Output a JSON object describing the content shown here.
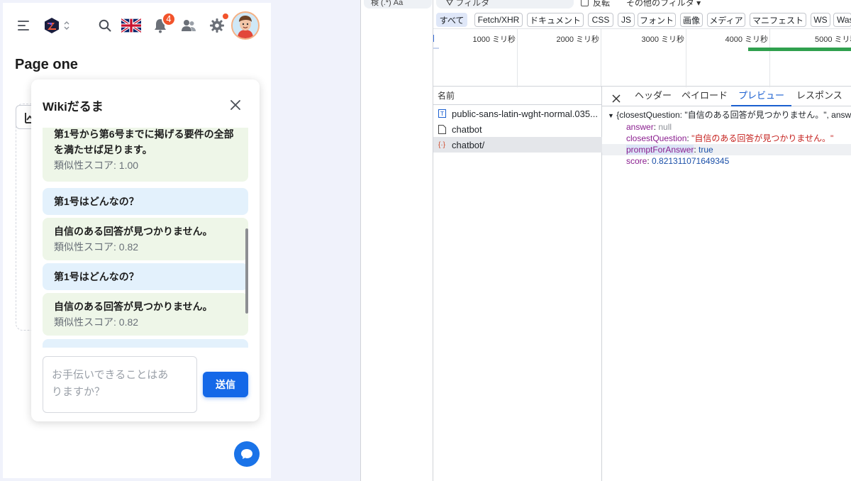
{
  "app": {
    "notification_count": "4",
    "page_title": "Page one",
    "chat": {
      "title": "Wikiだるま",
      "messages": [
        {
          "role": "bot",
          "text_lines": [
            "第1号から第6号までに掲げる要件の全部",
            "を満たせば足ります。"
          ],
          "score": "類似性スコア: 1.00"
        },
        {
          "role": "user",
          "text_lines": [
            "第1号はどんなの？"
          ]
        },
        {
          "role": "bot",
          "text_lines": [
            "自信のある回答が見つかりません。"
          ],
          "score": "類似性スコア: 0.82"
        },
        {
          "role": "user",
          "text_lines": [
            "第1号はどんなの？"
          ]
        },
        {
          "role": "bot",
          "text_lines": [
            "自信のある回答が見つかりません。"
          ],
          "score": "類似性スコア: 0.82"
        }
      ],
      "input_placeholder_lines": [
        "お手伝いできることはあ",
        "りますか？"
      ],
      "send_label": "送信"
    }
  },
  "devtools": {
    "search_label": "検 (.*) Aa",
    "filter_placeholder": "フィルタ",
    "invert_label": "反転",
    "more_filters_label": "その他のフィルタ",
    "type_filters": [
      "すべて",
      "Fetch/XHR",
      "ドキュメント",
      "CSS",
      "JS",
      "フォント",
      "画像",
      "メディア",
      "マニフェスト",
      "WS",
      "Wasm"
    ],
    "timeline_ticks": [
      "1000 ミリ秒",
      "2000 ミリ秒",
      "3000 ミリ秒",
      "4000 ミリ秒",
      "5000 ミリ秒"
    ],
    "name_header": "名前",
    "requests": [
      {
        "name": "public-sans-latin-wght-normal.035...",
        "type": "font"
      },
      {
        "name": "chatbot",
        "type": "doc"
      },
      {
        "name": "chatbot/",
        "type": "xhr"
      }
    ],
    "detail_tabs": [
      "ヘッダー",
      "ペイロード",
      "プレビュー",
      "レスポンス"
    ],
    "preview": {
      "summary": "{closestQuestion: \"自信のある回答が見つかりません。\", answer: null, ...",
      "answer_key": "answer",
      "answer_value": "null",
      "closest_key": "closestQuestion",
      "closest_value": "\"自信のある回答が見つかりません。\"",
      "prompt_key": "promptForAnswer",
      "prompt_value": "true",
      "score_key": "score",
      "score_value": "0.821311071649345"
    }
  }
}
